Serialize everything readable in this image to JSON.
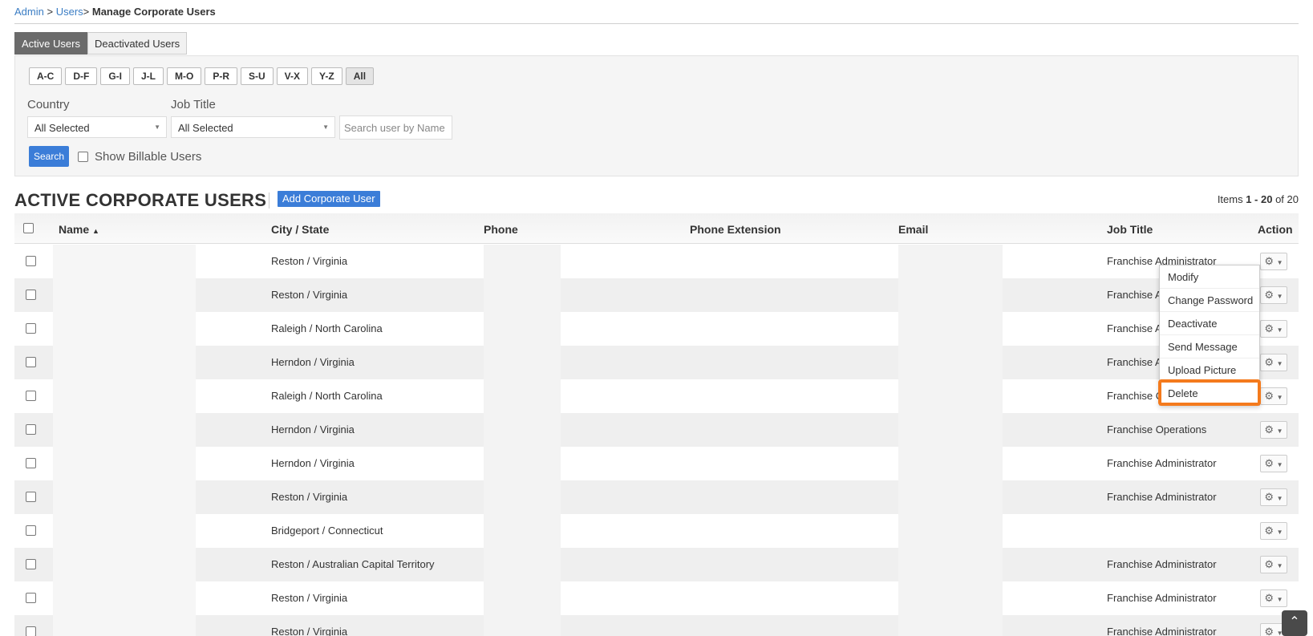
{
  "breadcrumb": {
    "admin": "Admin",
    "sep1": ">",
    "users": "Users",
    "sep2": ">",
    "current": "Manage Corporate Users"
  },
  "tabs": [
    "Active Users",
    "Deactivated Users"
  ],
  "letters": [
    "A-C",
    "D-F",
    "G-I",
    "J-L",
    "M-O",
    "P-R",
    "S-U",
    "V-X",
    "Y-Z",
    "All"
  ],
  "filters": {
    "country_label": "Country",
    "country_value": "All Selected",
    "job_label": "Job Title",
    "job_value": "All Selected",
    "search_placeholder": "Search user by Name",
    "search_button": "Search",
    "billable_label": "Show Billable Users"
  },
  "section": {
    "title": "ACTIVE CORPORATE USERS",
    "add_button": "Add Corporate User",
    "items_prefix": "Items ",
    "items_range": "1 - 20",
    "items_suffix": " of 20"
  },
  "columns": {
    "name": "Name",
    "city": "City / State",
    "phone": "Phone",
    "ext": "Phone Extension",
    "email": "Email",
    "job": "Job Title",
    "action": "Action"
  },
  "rows": [
    {
      "city": "Reston / Virginia",
      "job": "Franchise Administrator"
    },
    {
      "city": "Reston / Virginia",
      "job": "Franchise A"
    },
    {
      "city": "Raleigh / North Carolina",
      "job": "Franchise A"
    },
    {
      "city": "Herndon / Virginia",
      "job": "Franchise A"
    },
    {
      "city": "Raleigh / North Carolina",
      "job": "Franchise C"
    },
    {
      "city": "Herndon / Virginia",
      "job": "Franchise Operations"
    },
    {
      "city": "Herndon / Virginia",
      "job": "Franchise Administrator"
    },
    {
      "city": "Reston / Virginia",
      "job": "Franchise Administrator"
    },
    {
      "city": "Bridgeport / Connecticut",
      "job": ""
    },
    {
      "city": "Reston / Australian Capital Territory",
      "job": "Franchise Administrator"
    },
    {
      "city": "Reston / Virginia",
      "job": "Franchise Administrator"
    },
    {
      "city": "Reston / Virginia",
      "job": "Franchise Administrator"
    }
  ],
  "action_menu": [
    "Modify",
    "Change Password",
    "Deactivate",
    "Send Message",
    "Upload Picture",
    "Delete"
  ],
  "colors": {
    "accent": "#3b7dd8",
    "highlight": "#f47a1c"
  },
  "icons": {
    "gear": "gear-icon",
    "sort": "sort-asc-icon",
    "scroll": "scroll-top-icon"
  }
}
